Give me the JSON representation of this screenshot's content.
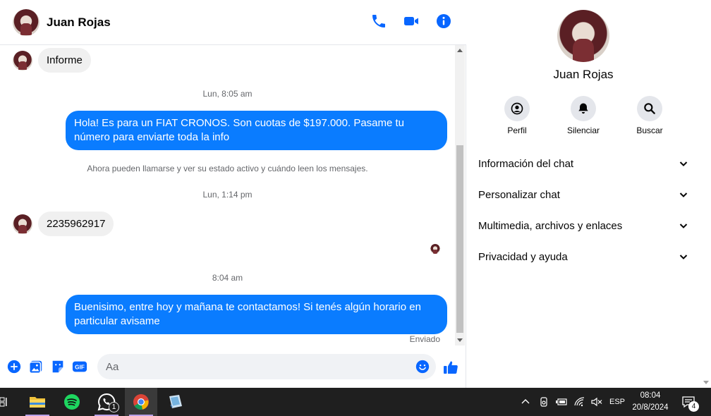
{
  "header": {
    "contact_name": "Juan Rojas"
  },
  "messages": {
    "in_1": "Informe",
    "time_1": "Lun, 8:05 am",
    "out_1": "Hola! Es para un FIAT CRONOS. Son cuotas de $197.000. Pasame tu número para enviarte toda la info",
    "system_1": "Ahora pueden llamarse y ver su estado activo y cuándo leen los mensajes.",
    "time_2": "Lun, 1:14 pm",
    "in_2": "2235962917",
    "time_3": "8:04 am",
    "out_2": "Buenisimo, entre hoy y mañana te contactamos! Si tenés algún horario en particular avisame",
    "status": "Enviado"
  },
  "composer": {
    "placeholder": "Aa",
    "gif_label": "GIF"
  },
  "info": {
    "name": "Juan Rojas",
    "actions": [
      {
        "label": "Perfil",
        "icon": "profile-icon"
      },
      {
        "label": "Silenciar",
        "icon": "bell-icon"
      },
      {
        "label": "Buscar",
        "icon": "search-icon"
      }
    ],
    "sections": [
      "Información del chat",
      "Personalizar chat",
      "Multimedia, archivos y enlaces",
      "Privacidad y ayuda"
    ]
  },
  "taskbar": {
    "whatsapp_badge": "1",
    "language": "ESP",
    "time": "08:04",
    "date": "20/8/2024",
    "notification_count": "4"
  },
  "colors": {
    "accent": "#0a7cff",
    "icon_blue": "#0866ff",
    "bubble_in": "#f0f0f0",
    "taskbar": "#1f1f1f"
  }
}
